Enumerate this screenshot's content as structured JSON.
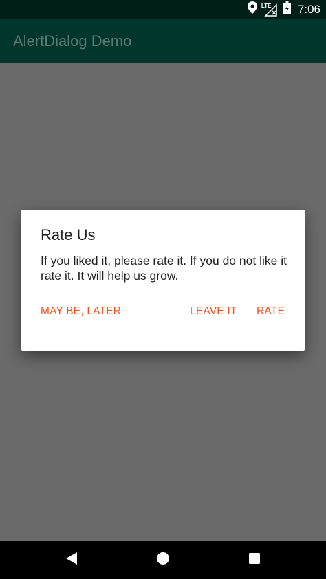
{
  "status_bar": {
    "time": "7:06",
    "network_label": "LTE",
    "icons": [
      "location-icon",
      "lte-signal-icon",
      "battery-charging-icon"
    ]
  },
  "app_bar": {
    "title": "AlertDialog Demo"
  },
  "dialog": {
    "title": "Rate Us",
    "message": "If you liked it, please rate it. If you do not like it rate it. It will help us grow.",
    "buttons": {
      "neutral": "MAY BE, LATER",
      "negative": "LEAVE IT",
      "positive": "RATE"
    }
  },
  "nav_bar": {
    "icons": [
      "back-icon",
      "home-icon",
      "recents-icon"
    ]
  },
  "colors": {
    "status_bar": "#001f17",
    "app_bar": "#00362b",
    "scrim": "#6a6a6a",
    "dialog_bg": "#ffffff",
    "accent": "#f4511e"
  }
}
